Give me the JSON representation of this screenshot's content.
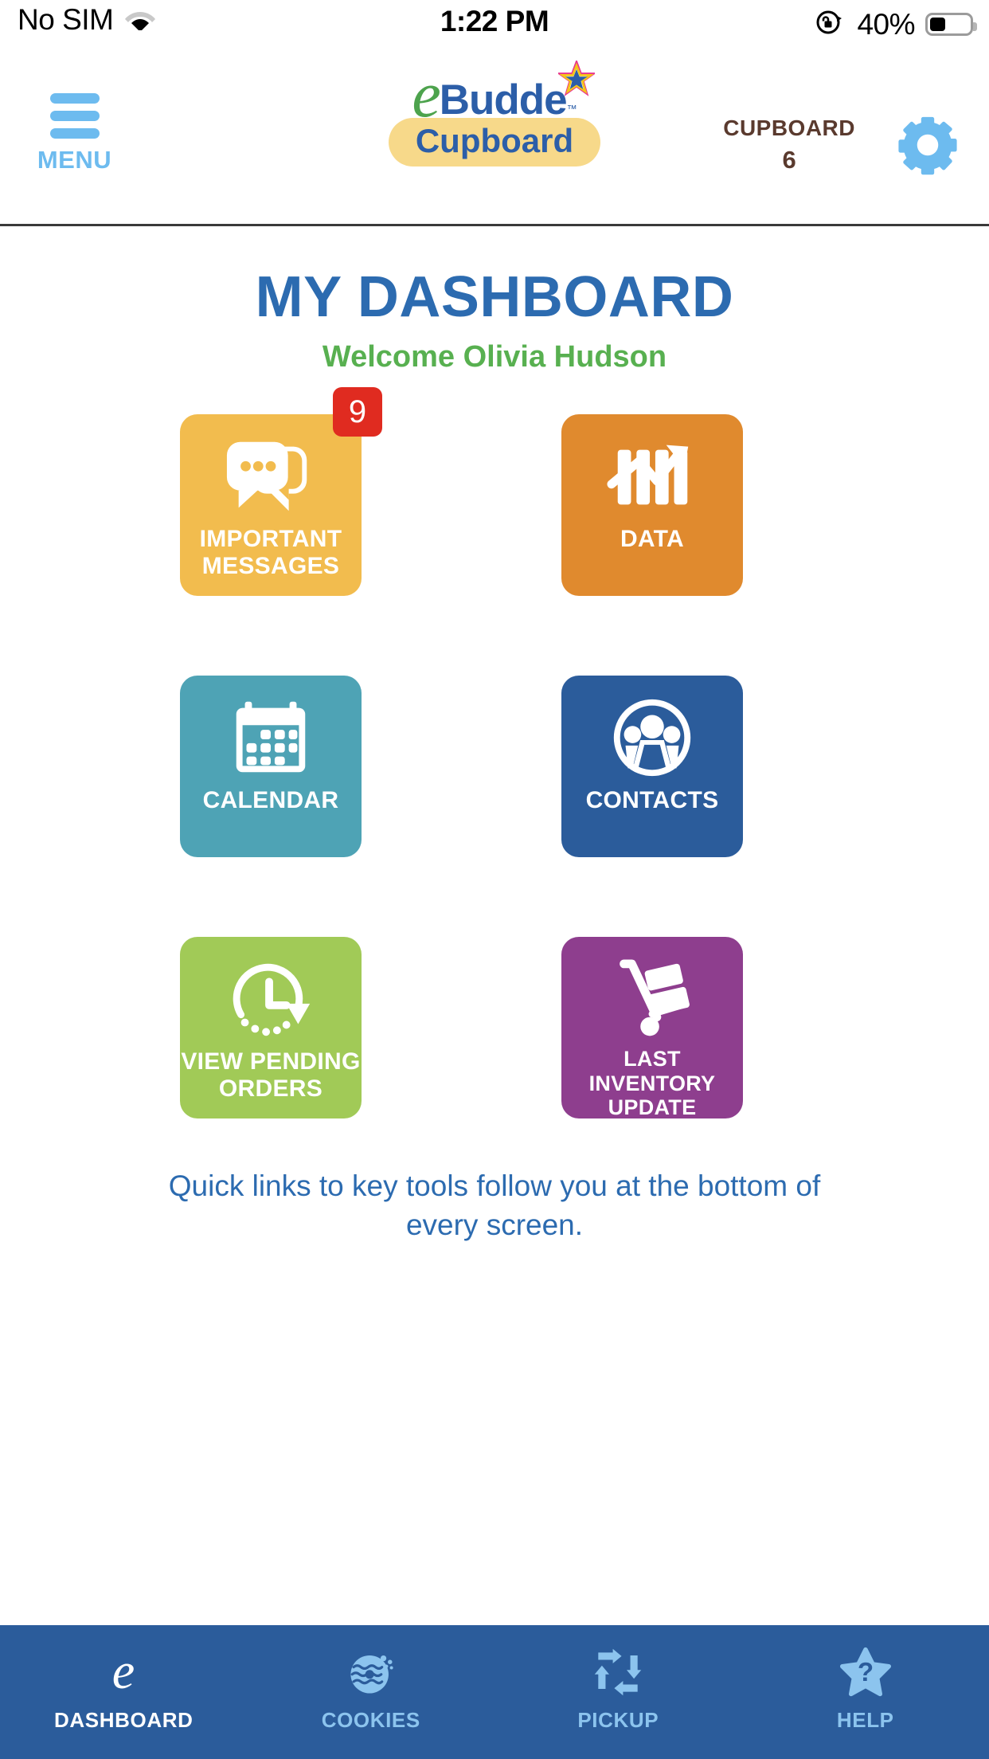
{
  "status_bar": {
    "carrier": "No SIM",
    "wifi_icon": "wifi-icon",
    "time": "1:22 PM",
    "rotation_lock_icon": "rotation-lock-icon",
    "battery_percent": "40%",
    "battery_level": 40,
    "battery_icon": "battery-icon"
  },
  "header": {
    "menu": {
      "label": "MENU",
      "icon": "hamburger-menu-icon"
    },
    "logo": {
      "e": "e",
      "budde": "Budde",
      "tm": "™",
      "cupboard": "Cupboard",
      "star_icon": "star-icon"
    },
    "cupboard": {
      "label": "CUPBOARD",
      "number": "6"
    },
    "settings": {
      "icon": "gear-icon"
    }
  },
  "main": {
    "title": "MY DASHBOARD",
    "welcome": "Welcome Olivia Hudson",
    "footnote": "Quick links to key tools follow you at the bottom of every screen.",
    "tiles": [
      {
        "label": "IMPORTANT MESSAGES",
        "icon": "chat-bubbles-icon",
        "color": "#F2BC4E",
        "badge": "9",
        "badge_color": "#E02B20"
      },
      {
        "label": "DATA",
        "icon": "bar-chart-arrow-icon",
        "color": "#E08A2E",
        "badge": null
      },
      {
        "label": "CALENDAR",
        "icon": "calendar-icon",
        "color": "#4EA3B5",
        "badge": null
      },
      {
        "label": "CONTACTS",
        "icon": "people-group-icon",
        "color": "#2B5C9B",
        "badge": null
      },
      {
        "label": "VIEW PENDING ORDERS",
        "icon": "clock-pending-icon",
        "color": "#A1CA57",
        "badge": null
      },
      {
        "label": "LAST INVENTORY UPDATE",
        "icon": "hand-truck-icon",
        "color": "#8E3E8E",
        "badge": null
      }
    ]
  },
  "bottom_nav": {
    "background": "#2B5C9B",
    "items": [
      {
        "label": "DASHBOARD",
        "icon": "ebudde-e-icon",
        "active": true
      },
      {
        "label": "COOKIES",
        "icon": "cookie-icon",
        "active": false
      },
      {
        "label": "PICKUP",
        "icon": "recycle-arrows-icon",
        "active": false
      },
      {
        "label": "HELP",
        "icon": "star-question-icon",
        "active": false
      }
    ]
  }
}
